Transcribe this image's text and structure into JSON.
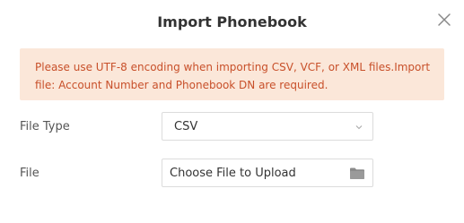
{
  "dialog": {
    "title": "Import Phonebook",
    "close_icon": "close-icon"
  },
  "notice": {
    "text": "Please use UTF-8 encoding when importing CSV, VCF, or XML files.Import file: Account Number and Phonebook DN are required."
  },
  "form": {
    "file_type": {
      "label": "File Type",
      "value": "CSV",
      "icon": "chevron-down-icon"
    },
    "file": {
      "label": "File",
      "placeholder": "Choose File to Upload",
      "icon": "folder-icon"
    }
  },
  "colors": {
    "notice_bg": "#fbe7d9",
    "notice_text": "#c8502a",
    "border": "#dcdcdc"
  }
}
